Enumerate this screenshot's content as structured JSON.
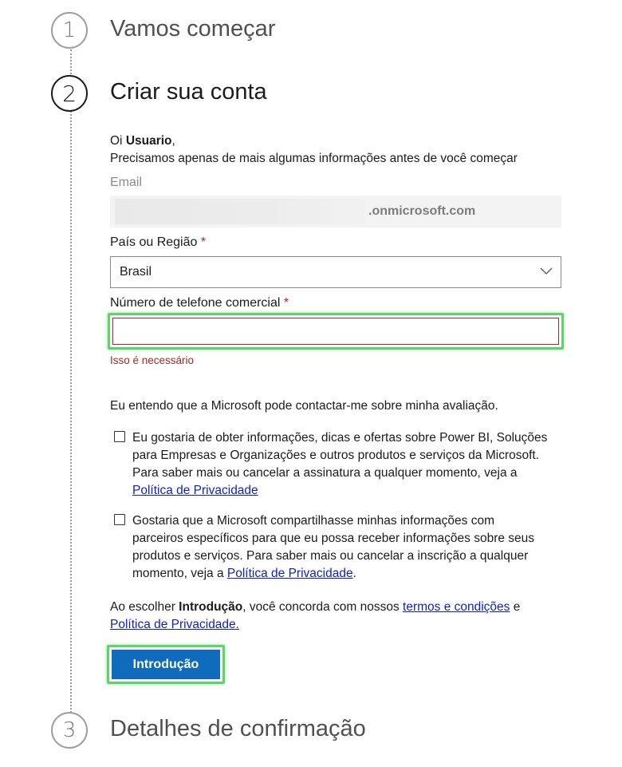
{
  "steps": [
    {
      "number": "1",
      "title": "Vamos começar"
    },
    {
      "number": "2",
      "title": "Criar sua conta"
    },
    {
      "number": "3",
      "title": "Detalhes de confirmação"
    }
  ],
  "greeting": {
    "prefix": "Oi ",
    "user": "Usuario",
    "suffix": ",",
    "message": "Precisamos apenas de mais algumas informações antes de você começar"
  },
  "email": {
    "label": "Email",
    "domain": ".onmicrosoft.com"
  },
  "country": {
    "label": "País ou Região",
    "required_mark": "*",
    "value": "Brasil"
  },
  "phone": {
    "label": "Número de telefone comercial",
    "required_mark": "*",
    "value": "",
    "error": "Isso é necessário"
  },
  "consent_text": "Eu entendo que a Microsoft pode contactar-me sobre minha avaliação.",
  "checkbox1": {
    "checked": false,
    "lines": [
      "Eu gostaria de obter informações, dicas e ofertas sobre Power BI, Soluções",
      "para Empresas e Organizações e outros produtos e serviços da Microsoft.",
      "Para saber mais ou cancelar a assinatura a qualquer momento, veja a"
    ],
    "link": "Política de Privacidade"
  },
  "checkbox2": {
    "checked": false,
    "lines": [
      "Gostaria que a Microsoft compartilhasse minhas informações com",
      "parceiros específicos para que eu possa receber informações sobre seus",
      "produtos e serviços. Para saber mais ou cancelar a inscrição a qualquer"
    ],
    "last_prefix": "momento, veja a ",
    "link": "Política de Privacidade",
    "last_suffix": "."
  },
  "terms": {
    "prefix": "Ao escolher ",
    "bold": "Introdução",
    "middle": ", você concorda com nossos ",
    "terms_link": "termos e condições",
    "and": " e",
    "privacy_link": "Política de Privacidade."
  },
  "submit_label": "Introdução",
  "colors": {
    "primary": "#0f6cbd",
    "error": "#a4262c",
    "highlight": "#5fd36b",
    "link": "#0b1fd0"
  }
}
